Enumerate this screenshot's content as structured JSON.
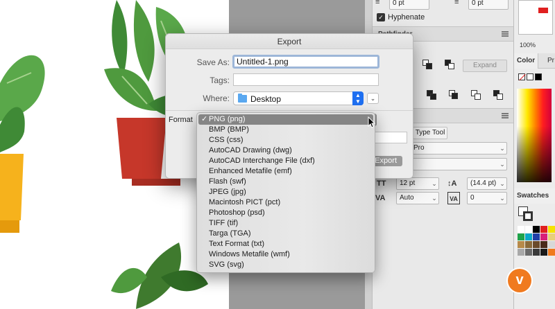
{
  "dialog": {
    "title": "Export",
    "save_as_label": "Save As:",
    "save_as_value": "Untitled-1.png",
    "tags_label": "Tags:",
    "tags_value": "",
    "where_label": "Where:",
    "where_value": "Desktop",
    "format_label": "Format",
    "export_button": "Export",
    "expand_icon": "chevron-down-icon"
  },
  "format_menu": {
    "selected": "PNG (png)",
    "items": [
      "PNG (png)",
      "BMP (BMP)",
      "CSS (css)",
      "AutoCAD Drawing (dwg)",
      "AutoCAD Interchange File (dxf)",
      "Enhanced Metafile (emf)",
      "Flash (swf)",
      "JPEG (jpg)",
      "Macintosh PICT (pct)",
      "Photoshop (psd)",
      "TIFF (tif)",
      "Targa (TGA)",
      "Text Format (txt)",
      "Windows Metafile (wmf)",
      "SVG (svg)"
    ]
  },
  "panels": {
    "space_before": "0 pt",
    "space_after": "0 pt",
    "hyphenate_label": "Hyphenate",
    "hyphenate_checked": true,
    "pathfinder_title": "Pathfinder",
    "expand_button": "Expand",
    "type_tool_button": "Type Tool",
    "font_family_partial": "Pro",
    "font_size": "12 pt",
    "leading": "(14.4 pt)",
    "kerning": "Auto",
    "tracking": "0",
    "zoom": "100%",
    "color_tab": "Color",
    "second_tab": "Pr",
    "swatches_title": "Swatches"
  },
  "colors": {
    "accent_blue": "#1e6ff1",
    "pot_red": "#c6372a",
    "pot_yellow": "#f6b21c",
    "leaf_green": "#4f9a3e",
    "vimeo_orange": "#f07a1f"
  },
  "badge": {
    "icon": "vimeo-logo-icon",
    "letter": "v"
  }
}
